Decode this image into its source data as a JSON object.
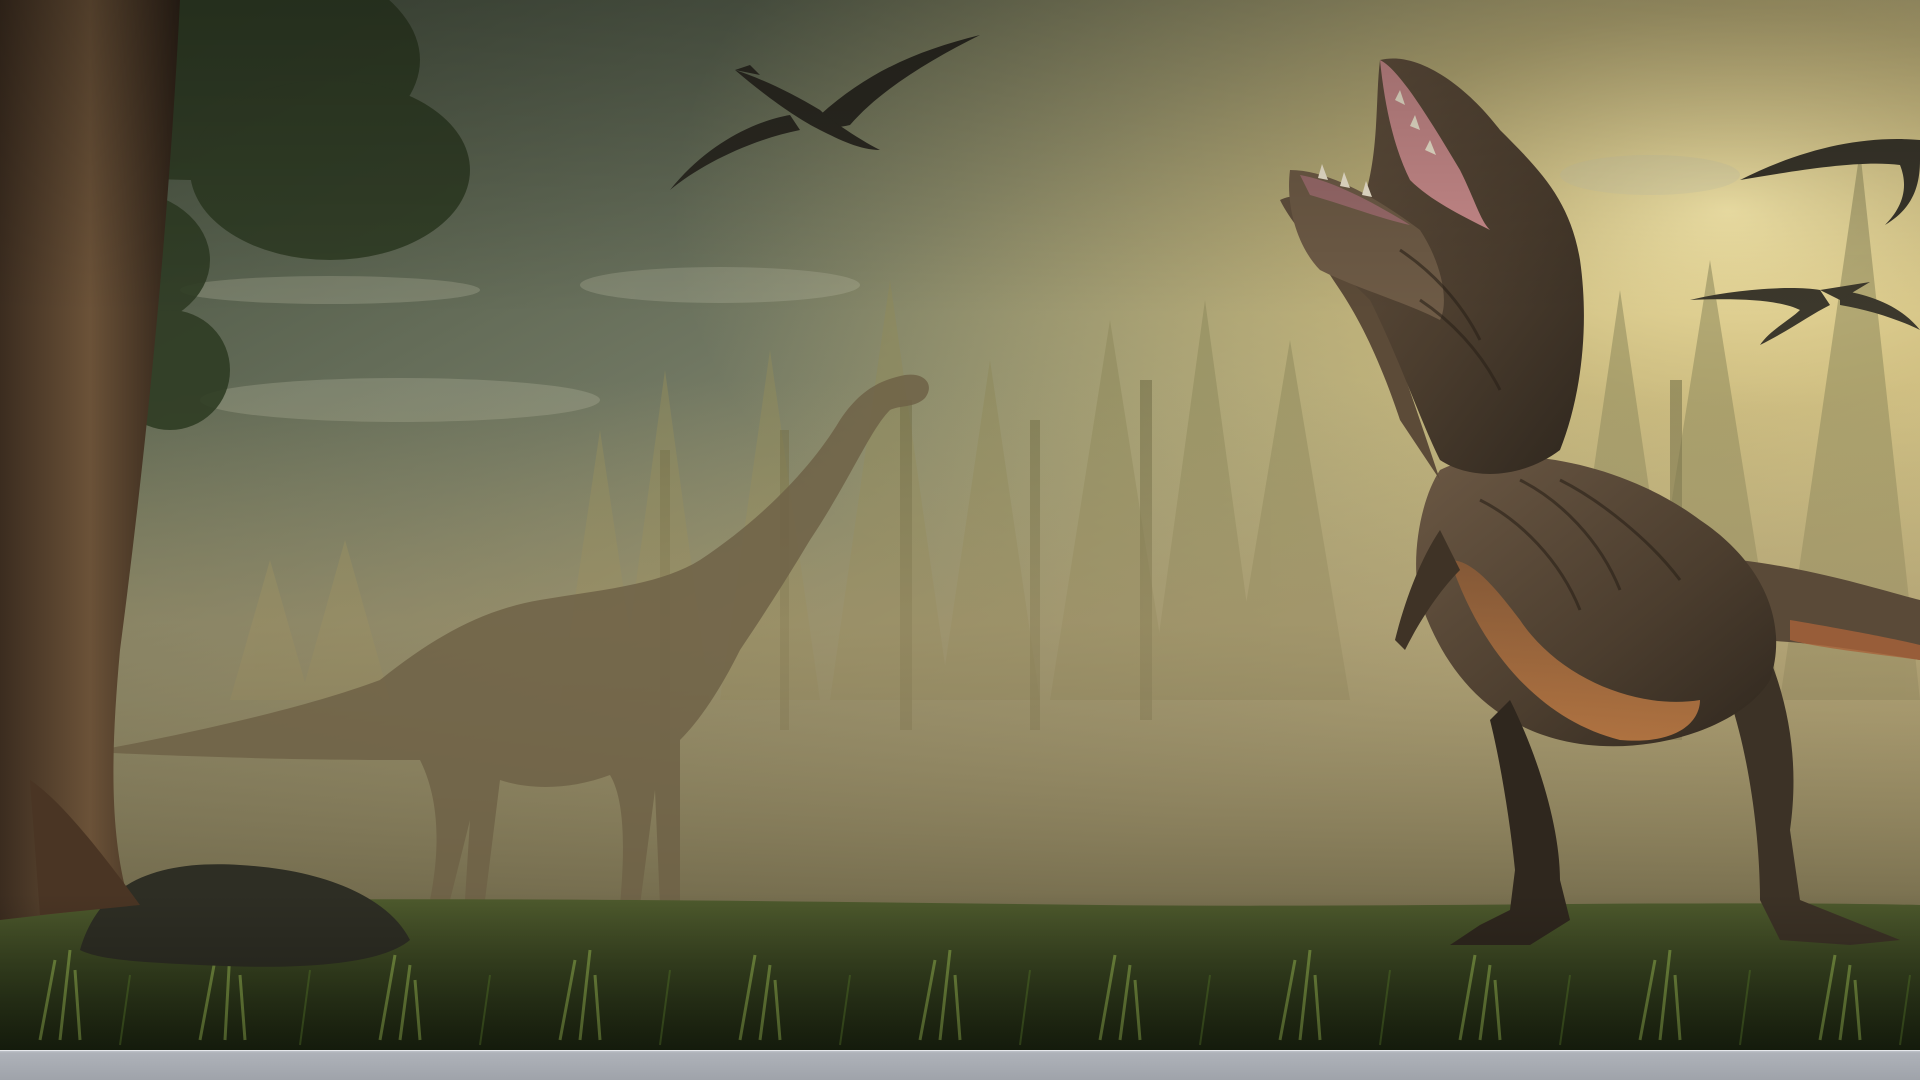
{
  "scene": {
    "subject": "prehistoric-forest-wallpaper",
    "elements": [
      "tyrannosaurus",
      "brachiosaurus",
      "pterosaur",
      "pterosaur",
      "pterosaur",
      "tree-trunk",
      "forest",
      "grass",
      "rock"
    ],
    "colors": {
      "sky_top": "#4d5a48",
      "sky_haze": "#b7b38a",
      "sun_glow": "#f2d48a",
      "fog": "#a9996c",
      "ground": "#3d4a22",
      "grass": "#6e8a3a",
      "rex_skin": "#5c4a36",
      "rex_belly": "#a86a3c",
      "brachio": "#6f6247"
    }
  },
  "taskbar": {
    "color": "#aeb2b9"
  }
}
